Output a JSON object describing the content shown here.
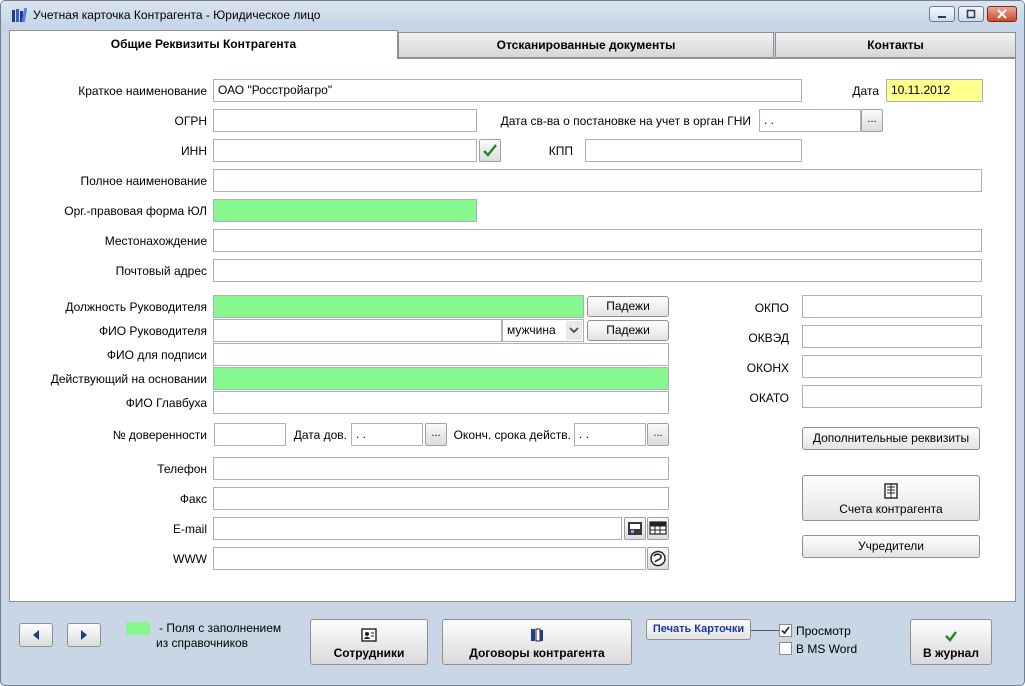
{
  "window": {
    "title": "Учетная карточка Контрагента - Юридическое лицо"
  },
  "tabs": [
    {
      "label": "Общие Реквизиты Контрагента"
    },
    {
      "label": "Отсканированные документы"
    },
    {
      "label": "Контакты"
    }
  ],
  "form": {
    "short_name_label": "Краткое наименование",
    "short_name_value": "ОАО \"Росстройагро\"",
    "date_label": "Дата",
    "date_value": "10.11.2012",
    "ogrn_label": "ОГРН",
    "ogrn_value": "",
    "gni_date_label": "Дата св-ва о постановке на учет в орган ГНИ",
    "gni_date_value": " .  .",
    "inn_label": "ИНН",
    "inn_value": "",
    "kpp_label": "КПП",
    "kpp_value": "",
    "full_name_label": "Полное наименование",
    "full_name_value": "",
    "legal_form_label": "Орг.-правовая форма ЮЛ",
    "legal_form_value": "",
    "location_label": "Местонахождение",
    "location_value": "",
    "postal_label": "Почтовый адрес",
    "postal_value": "",
    "director_position_label": "Должность Руководителя",
    "director_position_value": "",
    "director_fio_label": "ФИО Руководителя",
    "director_fio_value": "",
    "gender_value": "мужчина",
    "cases_label": "Падежи",
    "signature_fio_label": "ФИО для подписи",
    "signature_fio_value": "",
    "basis_label": "Действующий на основании",
    "basis_value": "",
    "accountant_label": "ФИО Главбуха",
    "accountant_value": "",
    "poa_number_label": "№ доверенности",
    "poa_number_value": "",
    "poa_date_label": "Дата дов.",
    "poa_date_value": " .  .",
    "poa_end_label": "Оконч. срока действ.",
    "poa_end_value": " .  .",
    "phone_label": "Телефон",
    "phone_value": "",
    "fax_label": "Факс",
    "fax_value": "",
    "email_label": "E-mail",
    "email_value": "",
    "www_label": "WWW",
    "www_value": "",
    "okpo_label": "ОКПО",
    "okpo_value": "",
    "okved_label": "ОКВЭД",
    "okved_value": "",
    "okonh_label": "ОКОНХ",
    "okonh_value": "",
    "okato_label": "ОКАТО",
    "okato_value": "",
    "extra_details_label": "Дополнительные реквизиты",
    "accounts_label": "Счета контрагента",
    "founders_label": "Учредители",
    "dots_label": "..."
  },
  "footer": {
    "legend_text_line1": "-  Поля с заполнением",
    "legend_text_line2": "из справочников",
    "employees_label": "Сотрудники",
    "contracts_label": "Договоры контрагента",
    "print_card_label": "Печать Карточки",
    "preview_label": "Просмотр",
    "preview_checked": true,
    "ms_word_label": "В MS Word",
    "ms_word_checked": false,
    "journal_label": "В журнал"
  },
  "colors": {
    "reference_field": "#87f88e",
    "date_field": "#ffff8c"
  }
}
